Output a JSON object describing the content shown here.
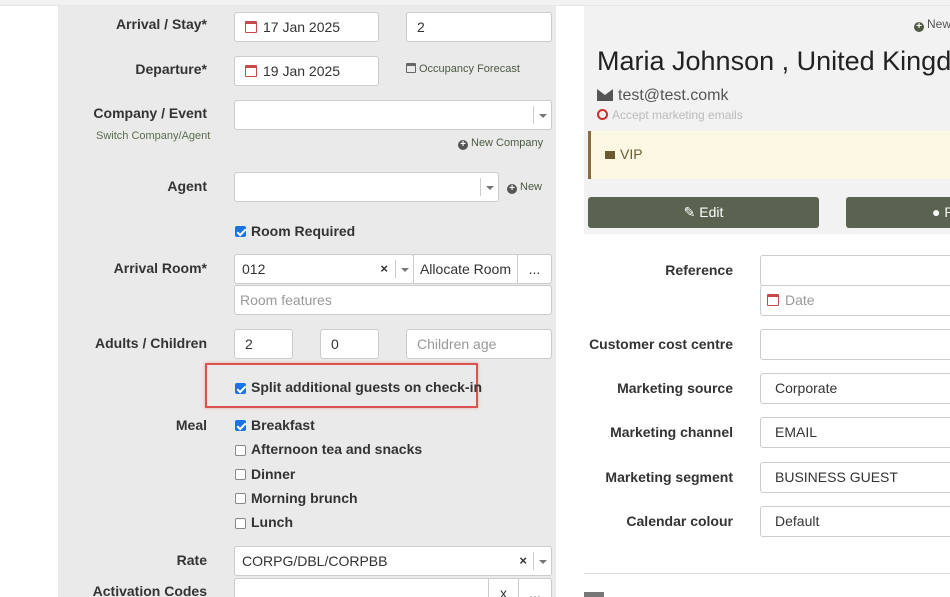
{
  "booking": {
    "arrival_label": "Arrival / Stay*",
    "arrival_date": "17 Jan 2025",
    "stay_nights": "2",
    "departure_label": "Departure*",
    "departure_date": "19 Jan 2025",
    "occupancy_forecast": "Occupancy Forecast",
    "company_label": "Company / Event",
    "switch_company": "Switch Company/Agent",
    "new_company": "New Company",
    "agent_label": "Agent",
    "new_agent": "New",
    "room_required": "Room Required",
    "arrival_room_label": "Arrival Room*",
    "arrival_room": "012",
    "allocate_room": "Allocate Room",
    "more_button": "...",
    "room_features_placeholder": "Room features",
    "adults_children_label": "Adults / Children",
    "adults": "2",
    "children": "0",
    "children_age_placeholder": "Children age",
    "split_guests": "Split additional guests on check-in",
    "meal_label": "Meal",
    "meals": [
      {
        "label": "Breakfast",
        "checked": true
      },
      {
        "label": "Afternoon tea and snacks",
        "checked": false
      },
      {
        "label": "Dinner",
        "checked": false
      },
      {
        "label": "Morning brunch",
        "checked": false
      },
      {
        "label": "Lunch",
        "checked": false
      }
    ],
    "rate_label": "Rate",
    "rate": "CORPG/DBL/CORPBB",
    "activation_codes_label": "Activation Codes",
    "clear_button": "x",
    "more_button_2": "..."
  },
  "guest": {
    "new_label": "New",
    "name": "Maria Johnson , United Kingd",
    "email": "test@test.comk",
    "accept_marketing": "Accept marketing emails",
    "vip": "VIP",
    "edit_button": "Edit",
    "second_button": "P"
  },
  "details": {
    "reference_label": "Reference",
    "reference_value": "",
    "date_placeholder": "Date",
    "cost_centre_label": "Customer cost centre",
    "marketing_source_label": "Marketing source",
    "marketing_source": "Corporate",
    "marketing_channel_label": "Marketing channel",
    "marketing_channel": "EMAIL",
    "marketing_segment_label": "Marketing segment",
    "marketing_segment": "BUSINESS GUEST",
    "calendar_colour_label": "Calendar colour",
    "calendar_colour": "Default"
  },
  "colors": {
    "panel_bg": "#eaeaea",
    "accent_green": "#5a6350",
    "highlight_red": "#d9534f",
    "checkbox_blue": "#1a73e8",
    "vip_bg": "#fcf8e3"
  }
}
